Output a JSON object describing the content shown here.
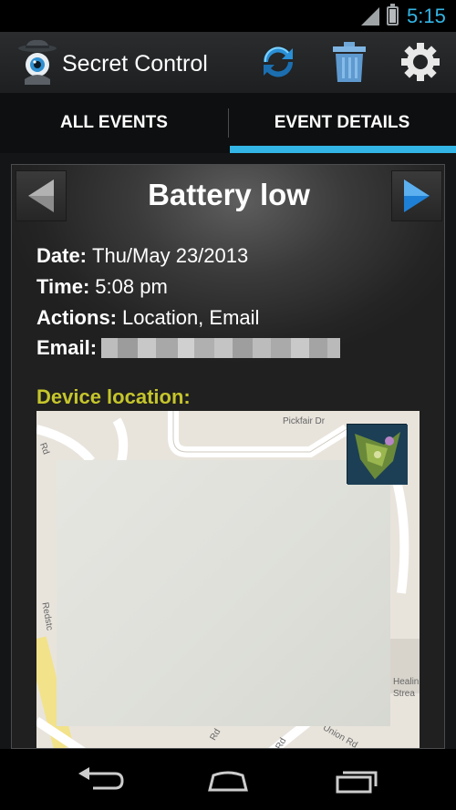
{
  "status_bar": {
    "time": "5:15",
    "icons": [
      "signal-icon",
      "battery-icon"
    ],
    "accent_color": "#33b5e5"
  },
  "action_bar": {
    "title": "Secret Control",
    "icons": [
      "spy-eye-app-icon",
      "sync-icon",
      "trash-icon",
      "gear-icon"
    ]
  },
  "tabs": [
    {
      "label": "ALL EVENTS",
      "selected": false
    },
    {
      "label": "EVENT DETAILS",
      "selected": true
    }
  ],
  "event": {
    "title": "Battery low",
    "fields": {
      "date_label": "Date:",
      "date_value": "Thu/May 23/2013",
      "time_label": "Time:",
      "time_value": "5:08 pm",
      "actions_label": "Actions:",
      "actions_value": "Location, Email",
      "email_label": "Email:"
    },
    "location_label": "Device location:",
    "location_label_color": "#c5c52c"
  },
  "map": {
    "street_labels": [
      "Pickfair Dr",
      "Rd",
      "Dr",
      "Healin",
      "Strea",
      "Rd",
      "Union Rd",
      "Rd",
      "Redstc"
    ]
  },
  "nav_bar": {
    "icons": [
      "back-icon",
      "home-icon",
      "recent-apps-icon"
    ]
  }
}
